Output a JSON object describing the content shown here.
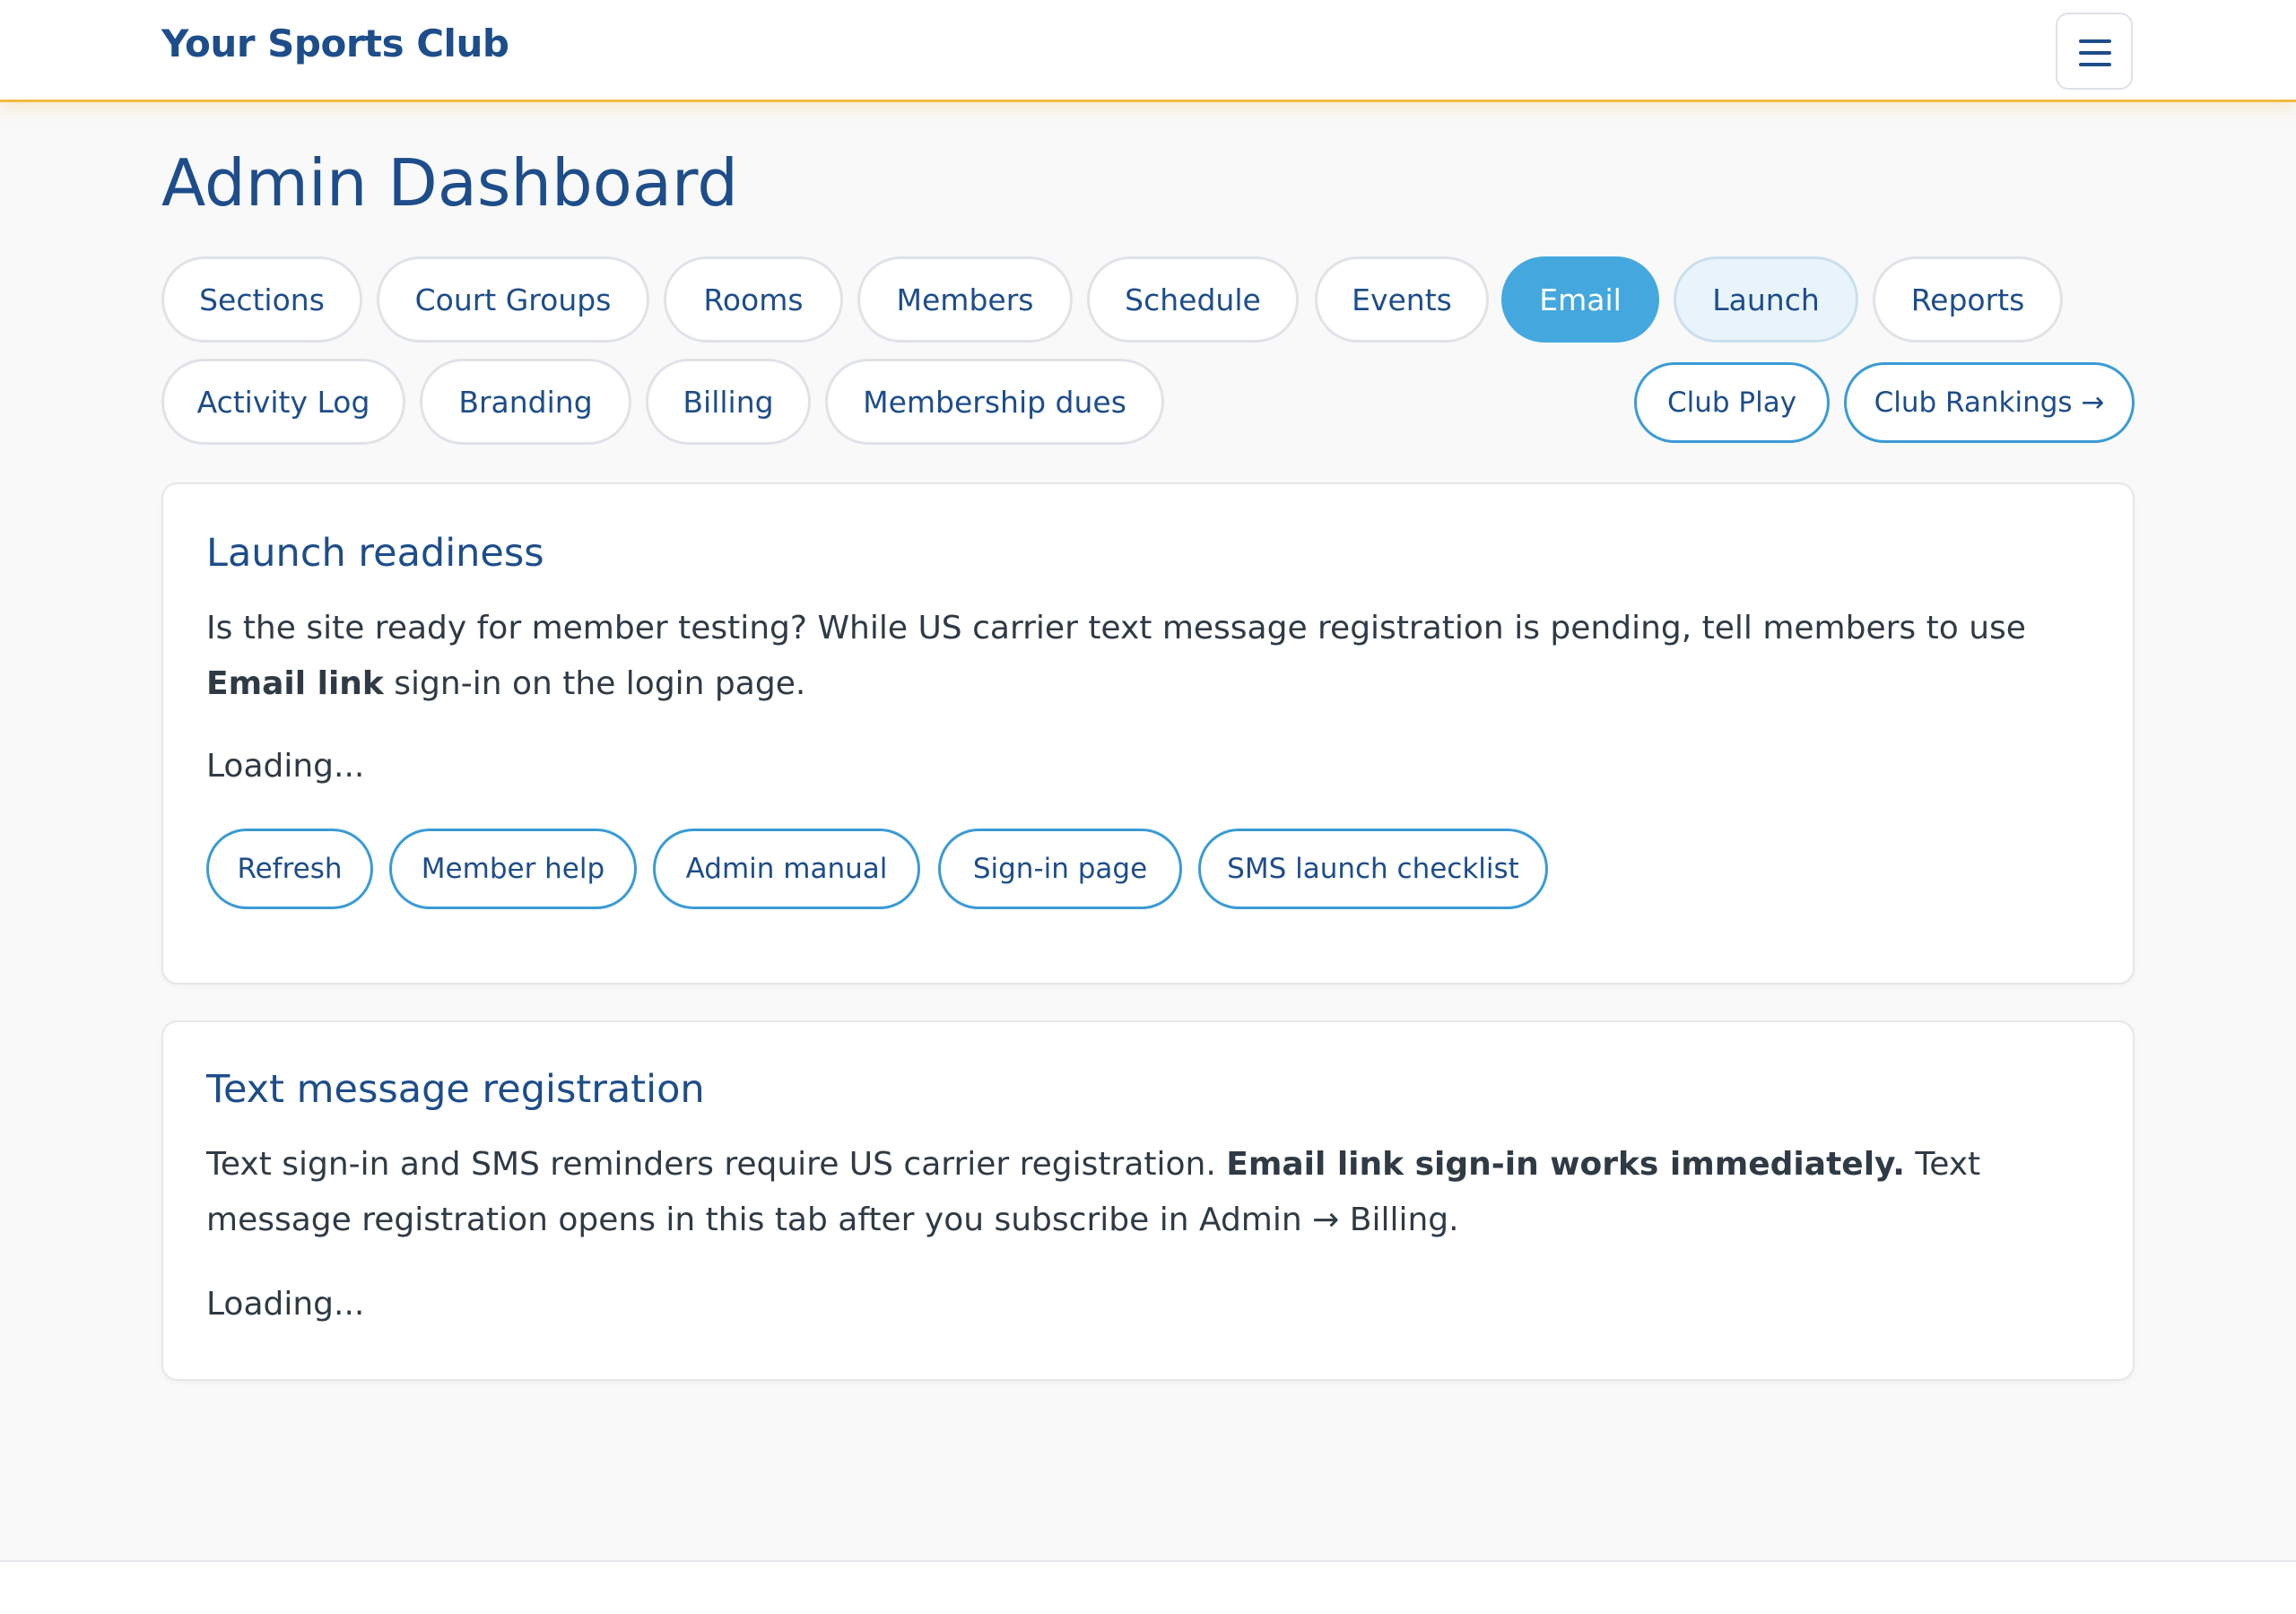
{
  "header": {
    "brand": "Your Sports Club",
    "menu_icon": "hamburger-menu-icon"
  },
  "page_title": "Admin Dashboard",
  "tabs": [
    {
      "label": "Sections"
    },
    {
      "label": "Court Groups"
    },
    {
      "label": "Rooms"
    },
    {
      "label": "Members"
    },
    {
      "label": "Schedule"
    },
    {
      "label": "Events"
    },
    {
      "label": "Email",
      "state": "active"
    },
    {
      "label": "Launch",
      "state": "highlighted"
    },
    {
      "label": "Reports"
    },
    {
      "label": "Activity Log"
    },
    {
      "label": "Branding"
    },
    {
      "label": "Billing"
    },
    {
      "label": "Membership dues"
    }
  ],
  "quick_links": [
    {
      "label": "Club Play"
    },
    {
      "label": "Club Rankings →"
    }
  ],
  "launch_card": {
    "title": "Launch readiness",
    "text_before": "Is the site ready for member testing? While US carrier text message registration is pending, tell members to use ",
    "text_bold": "Email link",
    "text_after": " sign-in on the login page.",
    "status": "Loading...",
    "buttons": [
      "Refresh",
      "Member help",
      "Admin manual",
      "Sign-in page",
      "SMS launch checklist"
    ]
  },
  "sms_card": {
    "title": "Text message registration",
    "text_before": "Text sign-in and SMS reminders require US carrier registration. ",
    "text_bold": "Email link sign-in works immediately.",
    "text_after": " Text message registration opens in this tab after you subscribe in Admin → Billing.",
    "status": "Loading..."
  },
  "colors": {
    "brand_blue": "#1d4d8a",
    "accent_blue": "#44a8de",
    "header_underline": "#f5b942",
    "background": "#f9f9f9"
  }
}
